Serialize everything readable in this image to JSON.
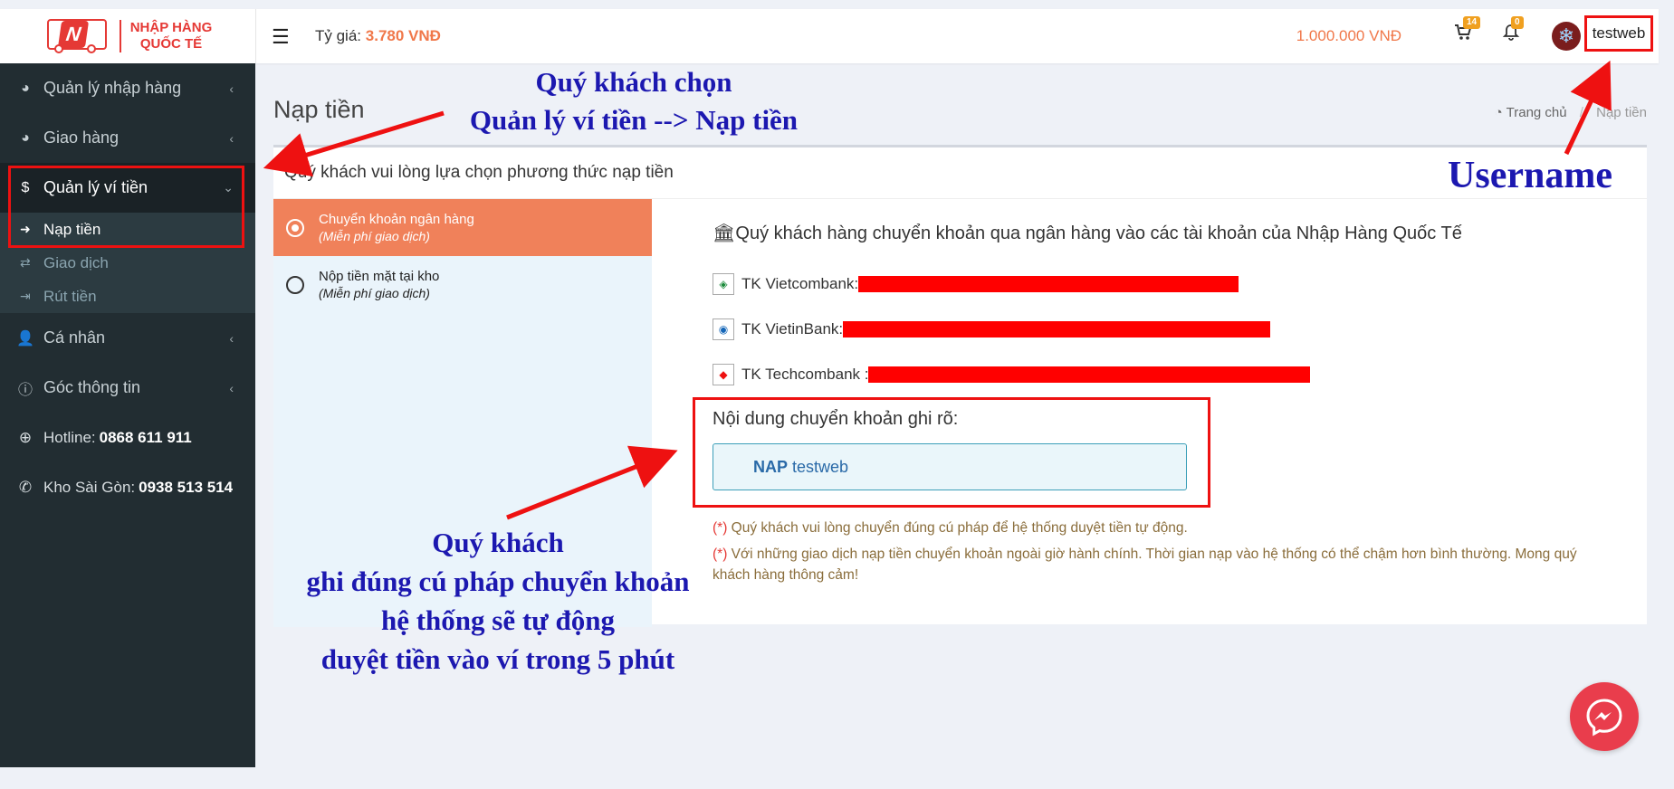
{
  "header": {
    "logo_line1": "NHẬP HÀNG",
    "logo_line2": "QUỐC TẾ",
    "logo_letter": "N",
    "rate_label": "Tỷ giá:",
    "rate_value": "3.780 VNĐ",
    "balance": "1.000.000 VNĐ",
    "cart_count": "14",
    "notif_count": "0",
    "username": "testweb"
  },
  "sidebar": {
    "items": [
      {
        "label": "Quản lý nhập hàng"
      },
      {
        "label": "Giao hàng"
      },
      {
        "label": "Quản lý ví tiền"
      },
      {
        "label": "Cá nhân"
      },
      {
        "label": "Góc thông tin"
      }
    ],
    "wallet_sub": [
      {
        "label": "Nạp tiền"
      },
      {
        "label": "Giao dịch"
      },
      {
        "label": "Rút tiền"
      }
    ],
    "hotline_label": "Hotline:",
    "hotline_value": "0868 611 911",
    "kho_label": "Kho Sài Gòn:",
    "kho_value": "0938 513 514"
  },
  "page": {
    "title": "Nạp tiền",
    "breadcrumb_home": "Trang chủ",
    "breadcrumb_current": "Nạp tiền"
  },
  "card": {
    "header": "Quý khách vui lòng lựa chọn phương thức nạp tiền",
    "methods": [
      {
        "title": "Chuyển khoản ngân hàng",
        "subtitle": "(Miễn phí giao dịch)"
      },
      {
        "title": "Nộp tiền mặt tại kho",
        "subtitle": "(Miễn phí giao dịch)"
      }
    ],
    "detail_title": "Quý khách hàng chuyển khoản qua ngân hàng vào các tài khoản của Nhập Hàng Quốc Tế",
    "banks": [
      {
        "label": "TK Vietcombank:"
      },
      {
        "label": "TK VietinBank:"
      },
      {
        "label": "TK Techcombank :"
      }
    ],
    "transfer_label": "Nội dung chuyển khoản ghi rõ:",
    "transfer_prefix": "NAP",
    "transfer_user": "testweb",
    "note_star": "(*)",
    "note1": "Quý khách vui lòng chuyển đúng cú pháp để hệ thống duyệt tiền tự động.",
    "note2": "Với những giao dịch nạp tiền chuyển khoản ngoài giờ hành chính. Thời gian nạp vào hệ thống có thể chậm hơn bình thường. Mong quý khách hàng thông cảm!"
  },
  "annotations": {
    "top_line1": "Quý khách chọn",
    "top_line2": "Quản lý ví tiền --> Nạp tiền",
    "username_label": "Username",
    "bottom_line1": "Quý khách",
    "bottom_line2": "ghi đúng cú pháp chuyển khoản",
    "bottom_line3": "hệ thống sẽ tự động",
    "bottom_line4": "duyệt tiền vào ví trong 5 phút"
  },
  "colors": {
    "accent": "#f0815a",
    "sidebar": "#222d32",
    "annotation": "#1c18b0",
    "highlight": "#ee1111"
  }
}
